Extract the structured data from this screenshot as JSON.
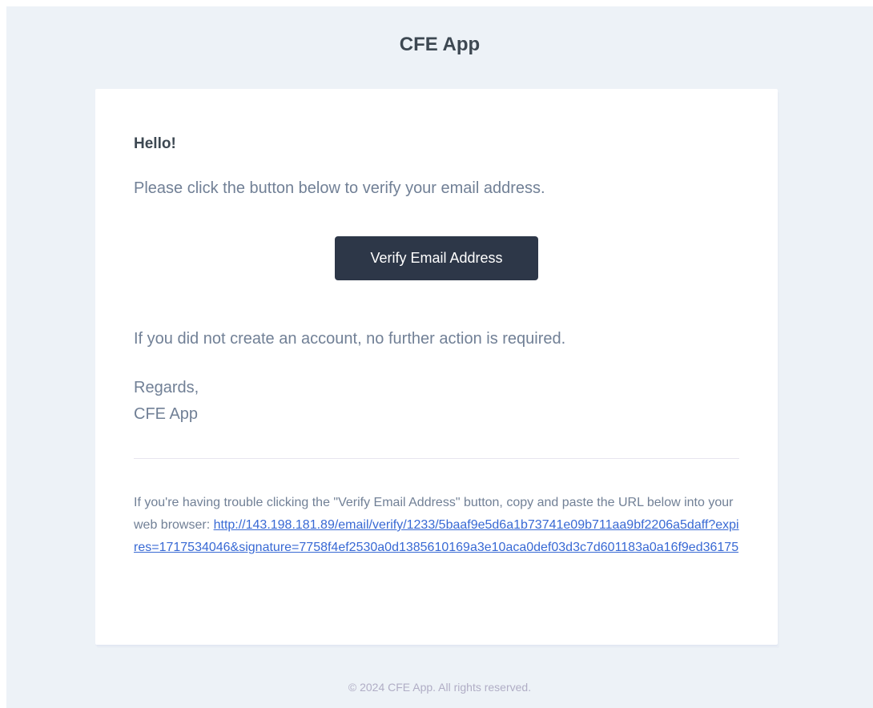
{
  "header": {
    "title": "CFE App"
  },
  "email": {
    "greeting": "Hello!",
    "intro": "Please click the button below to verify your email address.",
    "button_label": "Verify Email Address",
    "outro": "If you did not create an account, no further action is required.",
    "regards": "Regards,",
    "signature": "CFE App",
    "subcopy_text": "If you're having trouble clicking the \"Verify Email Address\" button, copy and paste the URL below into your web browser: ",
    "verify_url": "http://143.198.181.89/email/verify/1233/5baaf9e5d6a1b73741e09b711aa9bf2206a5daff?expires=1717534046&signature=7758f4ef2530a0d1385610169a3e10aca0def03d3c7d601183a0a16f9ed36175"
  },
  "footer": {
    "copyright": "© 2024 CFE App. All rights reserved."
  },
  "colors": {
    "page_background": "#edf2f7",
    "card_background": "#ffffff",
    "button_background": "#2d3748",
    "heading_text": "#3d4852",
    "body_text": "#718096",
    "link": "#3869d4",
    "footer_text": "#b0adc5"
  }
}
